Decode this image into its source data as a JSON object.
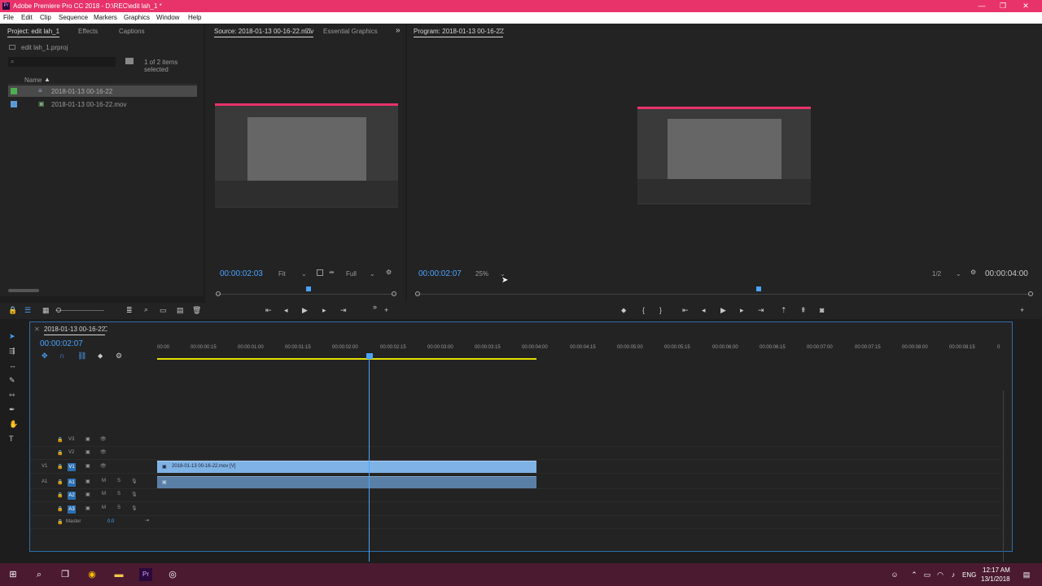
{
  "window": {
    "title": "Adobe Premiere Pro CC 2018 - D:\\REC\\edit lah_1 *",
    "app_icon": "Pr",
    "controls": [
      "minimize-icon",
      "restore-icon",
      "close-icon"
    ]
  },
  "menu": [
    "File",
    "Edit",
    "Clip",
    "Sequence",
    "Markers",
    "Graphics",
    "Window",
    "Help"
  ],
  "project_panel": {
    "tabs": [
      "Project: edit lah_1",
      "Effects",
      "Captions"
    ],
    "project_file": "edit lah_1.prproj",
    "selection_status": "1 of 2 items selected",
    "column_name": "Name",
    "items": [
      {
        "name": "2018-01-13 00-16-22",
        "color": "#4caf50",
        "type": "sequence"
      },
      {
        "name": "2018-01-13 00-16-22.mov",
        "color": "#5b9bd5",
        "type": "clip"
      }
    ]
  },
  "source_monitor": {
    "tabs": [
      "Source: 2018-01-13 00-16-22.mov",
      "Essential Graphics"
    ],
    "timecode": "00:00:02:03",
    "zoom": "Fit",
    "quality": "Full"
  },
  "program_monitor": {
    "tab": "Program: 2018-01-13 00-16-22",
    "timecode": "00:00:02:07",
    "zoom": "25%",
    "quality": "1/2",
    "duration": "00:00:04:00"
  },
  "timeline": {
    "sequence_name": "2018-01-13 00-16-22",
    "timecode": "00:00:02:07",
    "ruler": [
      "00:00",
      "00:00:00:15",
      "00:00:01:00",
      "00:00:01:15",
      "00:00:02:00",
      "00:00:02:15",
      "00:00:03:00",
      "00:00:03:15",
      "00:00:04:00",
      "00:00:04:15",
      "00:00:05:00",
      "00:00:05:15",
      "00:00:06:00",
      "00:00:06:15",
      "00:00:07:00",
      "00:00:07:15",
      "00:00:08:00",
      "00:00:08:15",
      "0"
    ],
    "video_tracks": [
      "V3",
      "V2",
      "V1"
    ],
    "audio_tracks": [
      "A1",
      "A2",
      "A3"
    ],
    "source_patch_video": "V1",
    "source_patch_audio": "A1",
    "master_label": "Master",
    "master_value": "0.0",
    "clip_label": "2018-01-13 00-16-22.mov [V]",
    "clip_color": "#7fb2e5",
    "audio_clip_color": "#5a7fa6"
  },
  "taskbar": {
    "time": "12:17 AM",
    "date": "13/1/2018",
    "lang": "ENG"
  },
  "colors": {
    "accent": "#e8336a",
    "timecode": "#4aa3ff",
    "work_area": "#e5e000"
  }
}
